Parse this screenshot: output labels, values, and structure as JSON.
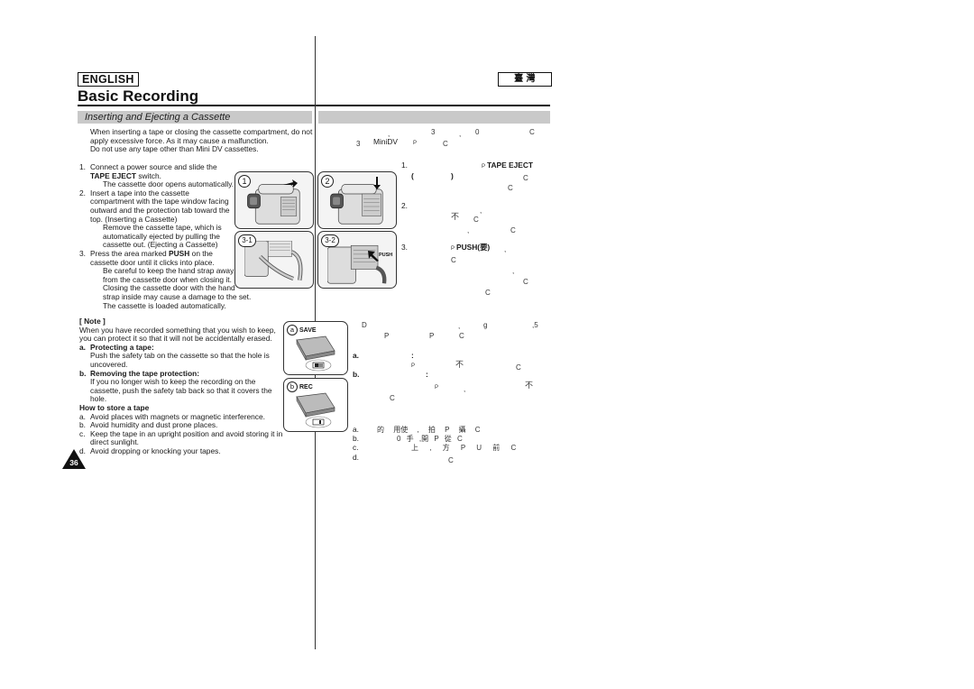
{
  "left": {
    "language_label": "ENGLISH",
    "page_title": "Basic Recording",
    "section_title": "Inserting and Ejecting a Cassette",
    "intro": [
      "When inserting a tape or closing the cassette compartment, do not",
      "apply excessive force. As it may cause a malfunction.",
      "Do not use any tape other than Mini DV cassettes."
    ],
    "steps": [
      {
        "num": "1.",
        "lines": [
          "Connect a power source and slide the"
        ],
        "bold_line": "TAPE EJECT",
        "bold_suffix": " switch.",
        "sub": [
          "The cassette door opens automatically."
        ]
      },
      {
        "num": "2.",
        "lines": [
          "Insert a tape into the cassette",
          "compartment with the tape window facing",
          "outward and the protection tab toward the",
          "top. (Inserting a Cassette)"
        ],
        "sub": [
          "Remove the cassette tape, which is",
          "automatically ejected by pulling the",
          "cassette out. (Ejecting a Cassette)"
        ]
      },
      {
        "num": "3.",
        "prefix": "Press the area marked ",
        "bold": "PUSH",
        "suffix": " on the",
        "lines": [
          "cassette door until it clicks into place."
        ],
        "sub": [
          "Be careful to keep the hand strap away",
          "from the cassette door when closing it.",
          "Closing the cassette door with the hand",
          "strap inside may cause a damage to the set.",
          "The cassette is loaded automatically."
        ]
      }
    ],
    "note": {
      "heading": "[ Note ]",
      "lines": [
        "When you have recorded something that you wish to keep,",
        "you can protect it so that it will not be accidentally erased."
      ],
      "items": [
        {
          "label": "a.",
          "title": "Protecting a tape:",
          "lines": [
            "Push the safety tab on the cassette so that the hole is",
            "uncovered."
          ]
        },
        {
          "label": "b.",
          "title": "Removing the tape protection:",
          "lines": [
            "If you no longer wish to keep the recording on the",
            "cassette, push the safety tab back so that it covers the",
            "hole."
          ]
        }
      ],
      "store_heading": "How to store a tape",
      "store_items": [
        {
          "label": "a.",
          "lines": [
            "Avoid places with magnets or magnetic interference."
          ]
        },
        {
          "label": "b.",
          "lines": [
            "Avoid humidity and dust prone places."
          ]
        },
        {
          "label": "c.",
          "lines": [
            "Keep the tape in an upright position and avoid storing it in",
            "direct sunlight."
          ]
        },
        {
          "label": "d.",
          "lines": [
            "Avoid dropping or knocking your tapes."
          ]
        }
      ]
    },
    "page_number": "36"
  },
  "figures": {
    "panels": [
      {
        "label": "1",
        "arrow": "right"
      },
      {
        "label": "2",
        "arrow": "down"
      },
      {
        "label": "3-1",
        "arrow": ""
      },
      {
        "label": "3-2",
        "arrow": "up-left",
        "tag": "PUSH"
      }
    ],
    "tapes": [
      {
        "letter": "a",
        "label": "SAVE"
      },
      {
        "letter": "b",
        "label": "REC"
      }
    ]
  },
  "right": {
    "language_label": "臺 灣",
    "intro": [
      {
        "pieces": [
          ",",
          "3",
          ",",
          "0",
          "C"
        ]
      },
      {
        "pieces": [
          "3",
          "MiniDV",
          "P",
          "C"
        ]
      }
    ],
    "steps": [
      {
        "num": "1.",
        "bold": "TAPE EJECT",
        "pieces": [
          "P",
          "(",
          ")",
          "C",
          "C"
        ]
      },
      {
        "num": "2.",
        "pieces": [
          ",",
          "不",
          "C",
          ",",
          "C"
        ]
      },
      {
        "num": "3.",
        "bold": "PUSH(",
        "bold_zh": "要)",
        "pieces": [
          "P",
          ",",
          "C",
          ",",
          "C",
          "C"
        ]
      }
    ],
    "note": {
      "pieces": [
        "D",
        ",",
        "g",
        ",5",
        "P",
        "P",
        "C"
      ],
      "items": [
        {
          "label": "a.",
          "pieces": [
            ":",
            "P",
            "不",
            "C"
          ]
        },
        {
          "label": "b.",
          "pieces": [
            ":",
            "P",
            ",",
            "不",
            "C"
          ]
        }
      ],
      "store_items": [
        {
          "label": "a.",
          "text": "的  用使  ,  拍  P 攝 C"
        },
        {
          "label": "b.",
          "text": "0 手 ,開 P 從 C"
        },
        {
          "label": "c.",
          "text": "上 ,  方 P U 前 C"
        },
        {
          "label": "d.",
          "text": "C"
        }
      ]
    }
  }
}
